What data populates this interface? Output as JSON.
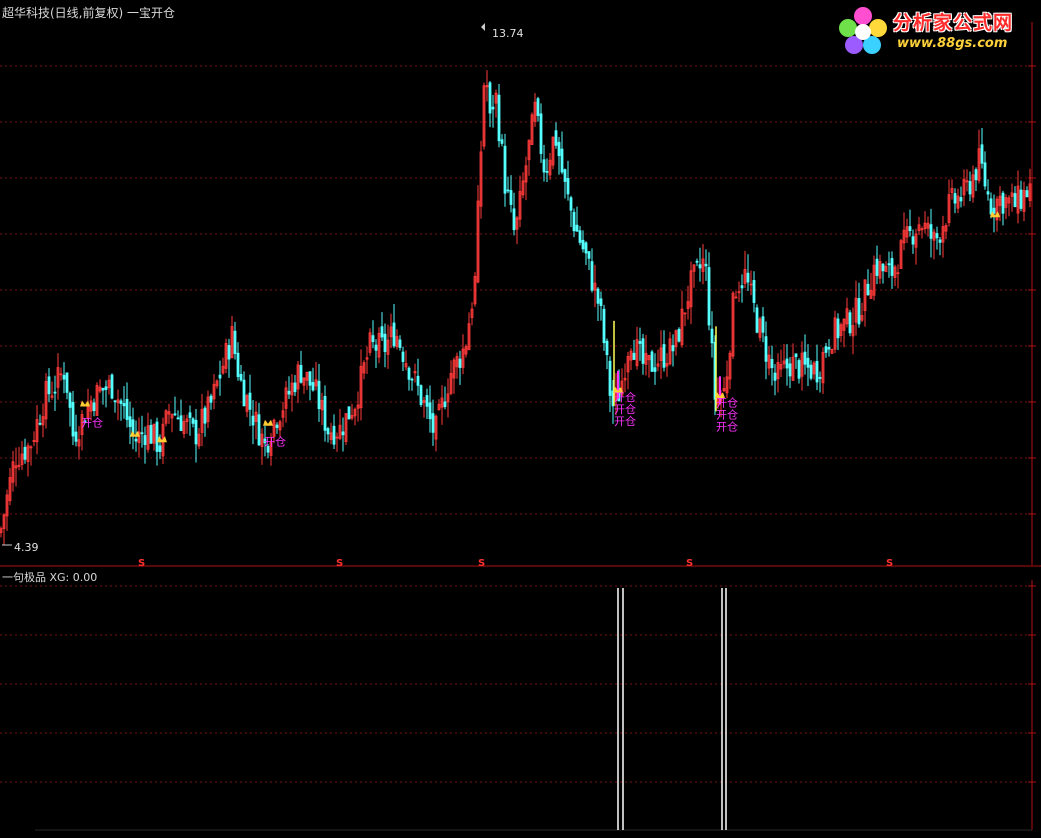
{
  "header": {
    "title": "超华科技(日线,前复权) 一宝开仓"
  },
  "logo": {
    "name": "分析家公式网",
    "url": "www.88gs.com"
  },
  "main_chart": {
    "high_label": "13.74",
    "low_label": "4.39",
    "signal_text": "开仓",
    "dividend_marker": "S",
    "colors": {
      "up": "#ff3a3a",
      "down": "#54ffff",
      "signal_text": "#ff33ff",
      "signal_line": "#ffff55",
      "icon": "#ffcc33",
      "grid": "#7a1010",
      "axis": "#b01010"
    }
  },
  "indicator": {
    "label": "一句极品",
    "value_text": "XG: 0.00"
  },
  "chart_data": [
    {
      "type": "candlestick",
      "title": "超华科技(日线,前复权) 一宝开仓",
      "y_range": [
        4.39,
        13.74
      ],
      "labels": {
        "max": "13.74",
        "min": "4.39"
      },
      "series": [
        {
          "name": "close",
          "x": [
            0,
            15,
            30,
            45,
            55,
            65,
            73,
            80,
            90,
            100,
            112,
            125,
            135,
            147,
            160,
            170,
            185,
            195,
            210,
            220,
            232,
            240,
            250,
            265,
            275,
            285,
            300,
            315,
            328,
            340,
            355,
            370,
            385,
            395,
            410,
            425,
            435,
            450,
            465,
            475,
            480,
            485,
            490,
            495,
            505,
            515,
            525,
            535,
            545,
            555,
            565,
            575,
            585,
            600,
            612,
            620,
            630,
            645,
            660,
            675,
            690,
            705,
            715,
            725,
            735,
            745,
            760,
            775,
            790,
            805,
            818,
            830,
            845,
            860,
            875,
            890,
            905,
            920,
            935,
            950,
            965,
            980,
            990,
            1000,
            1015,
            1030
          ],
          "values": [
            4.6,
            6.0,
            6.2,
            7.1,
            7.3,
            7.6,
            6.4,
            6.6,
            7.0,
            7.2,
            7.3,
            6.8,
            6.3,
            6.5,
            6.2,
            6.9,
            6.6,
            6.4,
            6.9,
            7.5,
            8.2,
            7.4,
            6.9,
            6.2,
            6.7,
            7.0,
            7.6,
            7.2,
            6.5,
            6.5,
            7.0,
            8.0,
            8.0,
            8.3,
            7.6,
            6.9,
            6.4,
            7.5,
            8.0,
            9.2,
            11.2,
            13.2,
            12.1,
            12.7,
            11.0,
            10.0,
            11.2,
            12.3,
            11.2,
            11.9,
            10.9,
            10.2,
            9.7,
            8.7,
            6.9,
            7.2,
            8.2,
            7.6,
            7.8,
            8.0,
            9.1,
            9.6,
            7.1,
            7.2,
            9.1,
            9.3,
            8.3,
            7.4,
            7.7,
            7.6,
            7.6,
            8.2,
            8.4,
            8.7,
            9.5,
            9.3,
            9.9,
            10.3,
            9.9,
            10.6,
            10.8,
            11.4,
            10.6,
            10.7,
            10.6,
            10.9
          ]
        }
      ],
      "signals": [
        {
          "type": "开仓",
          "x": 85,
          "price": 6.95
        },
        {
          "type": "开仓",
          "x": 135,
          "price": 6.4
        },
        {
          "type": "开仓",
          "x": 162,
          "price": 6.3
        },
        {
          "type": "开仓",
          "x": 268,
          "price": 6.6
        },
        {
          "type": "开仓",
          "x": 618,
          "price": 7.2
        },
        {
          "type": "开仓",
          "x": 720,
          "price": 7.1
        },
        {
          "type": "开仓",
          "x": 995,
          "price": 10.4
        }
      ]
    },
    {
      "type": "bar",
      "title": "一句极品",
      "series": [
        {
          "name": "XG",
          "x": [
            618,
            623,
            722,
            726
          ],
          "values": [
            1,
            1,
            1,
            1
          ]
        }
      ],
      "current": "XG: 0.00"
    }
  ]
}
